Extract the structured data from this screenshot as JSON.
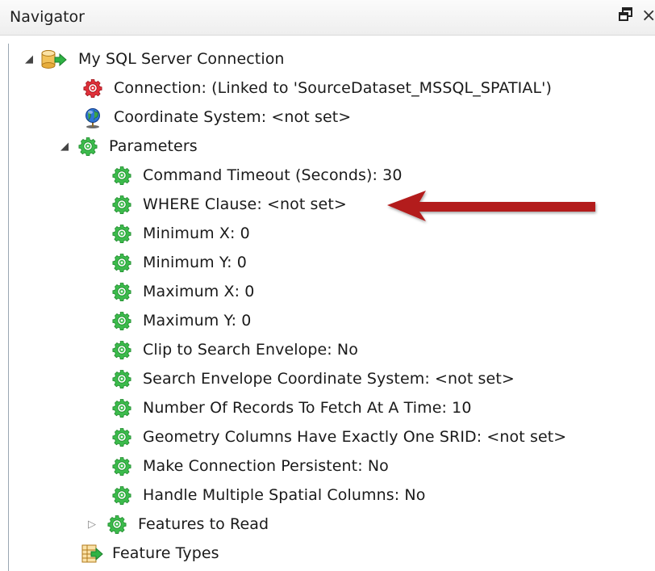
{
  "window": {
    "title": "Navigator",
    "restore_glyph": "🗗",
    "close_glyph": "×"
  },
  "tree": {
    "connection": {
      "label": "My SQL Server Connection",
      "icon": "database-connection-icon",
      "expanded": true
    },
    "connection_link": {
      "label": "Connection: (Linked to 'SourceDataset_MSSQL_SPATIAL')",
      "icon": "red-gear-icon"
    },
    "coordinate_system": {
      "label": "Coordinate System: <not set>",
      "icon": "globe-icon"
    },
    "parameters": {
      "label": "Parameters",
      "icon": "green-gear-icon",
      "expanded": true,
      "items": [
        "Command Timeout (Seconds): 30",
        "WHERE Clause: <not set>",
        "Minimum X: 0",
        "Minimum Y: 0",
        "Maximum X: 0",
        "Maximum Y: 0",
        "Clip to Search Envelope: No",
        "Search Envelope Coordinate System: <not set>",
        "Number Of Records To Fetch At A Time: 10",
        "Geometry Columns Have Exactly One SRID: <not set>",
        "Make Connection Persistent: No",
        "Handle Multiple Spatial Columns: No"
      ]
    },
    "features_to_read": {
      "label": "Features to Read",
      "icon": "green-gear-icon",
      "expanded": false
    },
    "feature_types": {
      "label": "Feature Types",
      "icon": "feature-types-icon"
    }
  },
  "annotation": {
    "arrow_color": "#b31b1b",
    "points_to": "WHERE Clause: <not set>"
  },
  "colors": {
    "gear_green": "#39b54a",
    "gear_red": "#d9232e",
    "tree_line": "#9aa6b2"
  }
}
